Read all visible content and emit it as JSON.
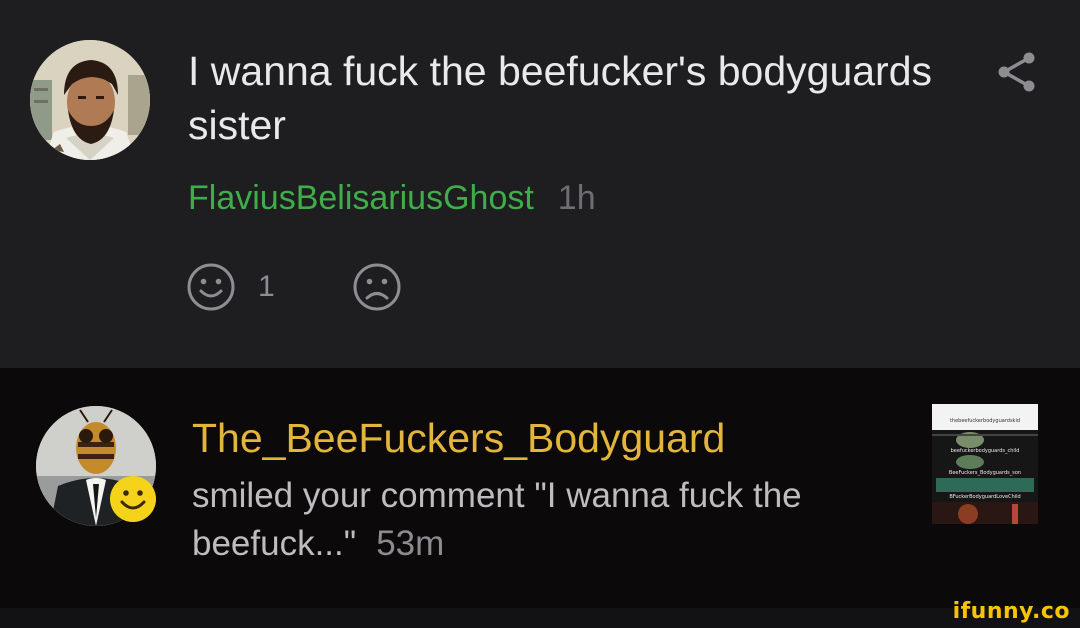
{
  "comment": {
    "text": "I wanna fuck the beefucker's bodyguards sister",
    "author": "FlaviusBelisariusGhost",
    "time_ago": "1h",
    "smile_count": "1",
    "share_icon": "share-icon",
    "smile_icon": "smile-icon",
    "frown_icon": "frown-icon",
    "author_color": "#3fae49"
  },
  "notification": {
    "username": "The_BeeFuckers_Bodyguard",
    "message": "smiled your comment \"I wanna fuck the beefuck...\"",
    "time_ago": "53m",
    "badge_icon": "smile-badge-icon",
    "username_color": "#e3b53c",
    "thumbnail_labels": [
      "thebeefuckerbodyguardskid",
      "beefuckerbodyguards_child",
      "BeeFuckers_Bodyguards_son",
      "BFuckerBodyguardLoveChild"
    ]
  },
  "watermark": {
    "text": "ifunny.co",
    "color": "#f7c500"
  }
}
